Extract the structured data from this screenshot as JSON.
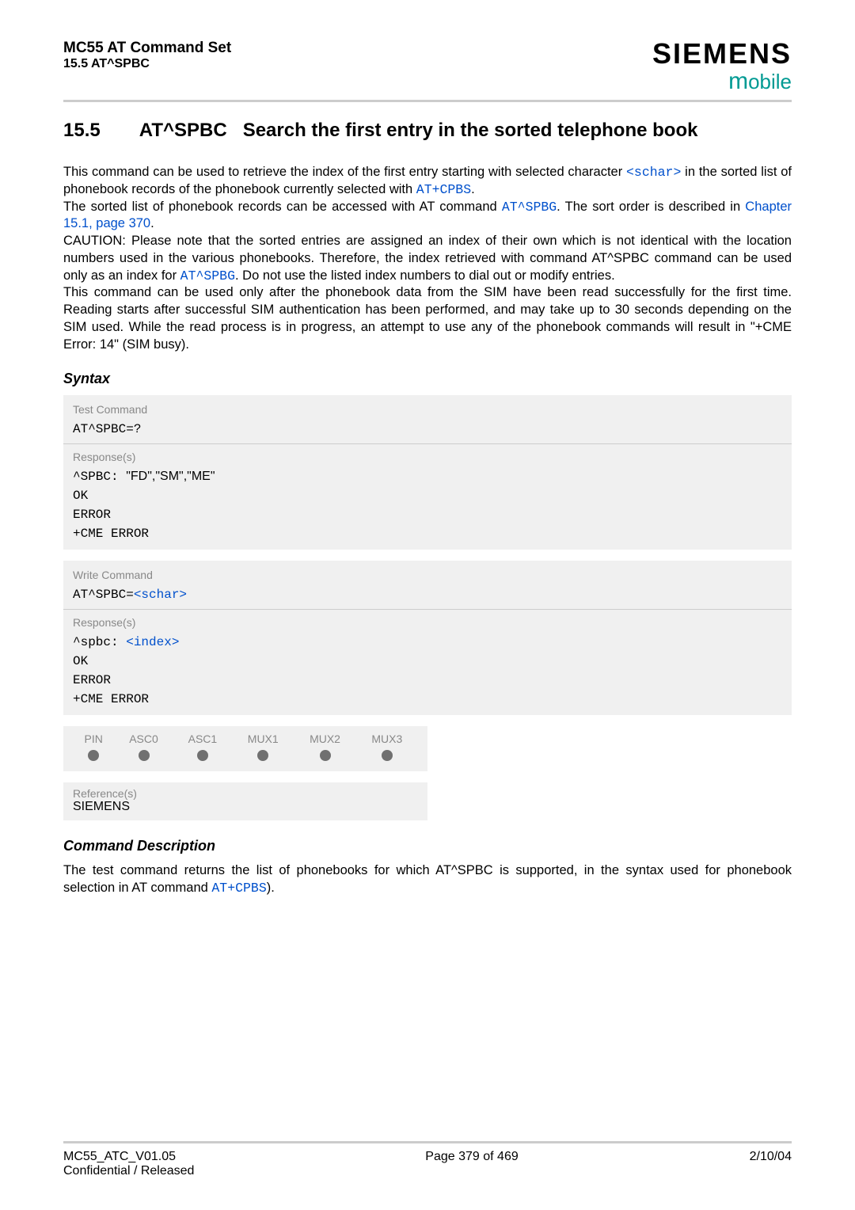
{
  "header": {
    "title": "MC55 AT Command Set",
    "subtitle": "15.5 AT^SPBC",
    "brand": "SIEMENS",
    "brand_sub_m": "m",
    "brand_sub_rest": "obile"
  },
  "section": {
    "number": "15.5",
    "cmd": "AT^SPBC",
    "title_rest": "Search the first entry in the sorted telephone book"
  },
  "para": {
    "p1a": "This command can be used to retrieve the index of the first entry starting with selected character ",
    "p1_schar": "<schar>",
    "p1b": " in the sorted list of phonebook records of the phonebook currently selected with ",
    "p1_cpbs": "AT+CPBS",
    "p1c": ".",
    "p2a": "The sorted list of phonebook records can be accessed with AT command ",
    "p2_spbg": "AT^SPBG",
    "p2b": ". The sort order is described in ",
    "p2_chap": "Chapter 15.1, page 370",
    "p2c": ".",
    "p3a": "CAUTION: Please note that the sorted entries are assigned an index of their own which is not identical with the location numbers used in the various phonebooks. Therefore, the index retrieved with command AT^SPBC command can be used only as an index for ",
    "p3_spbg": "AT^SPBG",
    "p3b": ". Do not use the listed index numbers to dial out or modify entries.",
    "p4": "This command can be used only after the phonebook data from the SIM have been read successfully for the first time. Reading starts after successful SIM authentication has been performed, and may take up to 30 seconds depending on the SIM used. While the read process is in progress, an attempt to use any of the phonebook commands will result in \"+CME Error: 14\" (SIM busy)."
  },
  "syntax_label": "Syntax",
  "test_box": {
    "lbl1": "Test Command",
    "line1": "AT^SPBC=?",
    "lbl2": "Response(s)",
    "r1a": "^SPBC: ",
    "r1b": "\"FD\",\"SM\",\"ME\"",
    "r2": "OK",
    "r3": "ERROR",
    "r4": "+CME ERROR"
  },
  "write_box": {
    "lbl1": "Write Command",
    "line1a": "AT^SPBC=",
    "line1b": "<schar>",
    "lbl2": "Response(s)",
    "r1a": "^spbc: ",
    "r1b": "<index>",
    "r2": "OK",
    "r3": "ERROR",
    "r4": "+CME ERROR"
  },
  "pin_table": {
    "headers": [
      "PIN",
      "ASC0",
      "ASC1",
      "MUX1",
      "MUX2",
      "MUX3"
    ]
  },
  "ref_box": {
    "lbl": "Reference(s)",
    "val": "SIEMENS"
  },
  "cmd_desc_label": "Command Description",
  "cmd_desc": {
    "a": "The test command returns the list of phonebooks for which AT^SPBC is supported, in the syntax used for phonebook selection in AT command ",
    "cpbs": "AT+CPBS",
    "b": ")."
  },
  "footer": {
    "left1": "MC55_ATC_V01.05",
    "left2": "Confidential / Released",
    "center": "Page 379 of 469",
    "right": "2/10/04"
  }
}
